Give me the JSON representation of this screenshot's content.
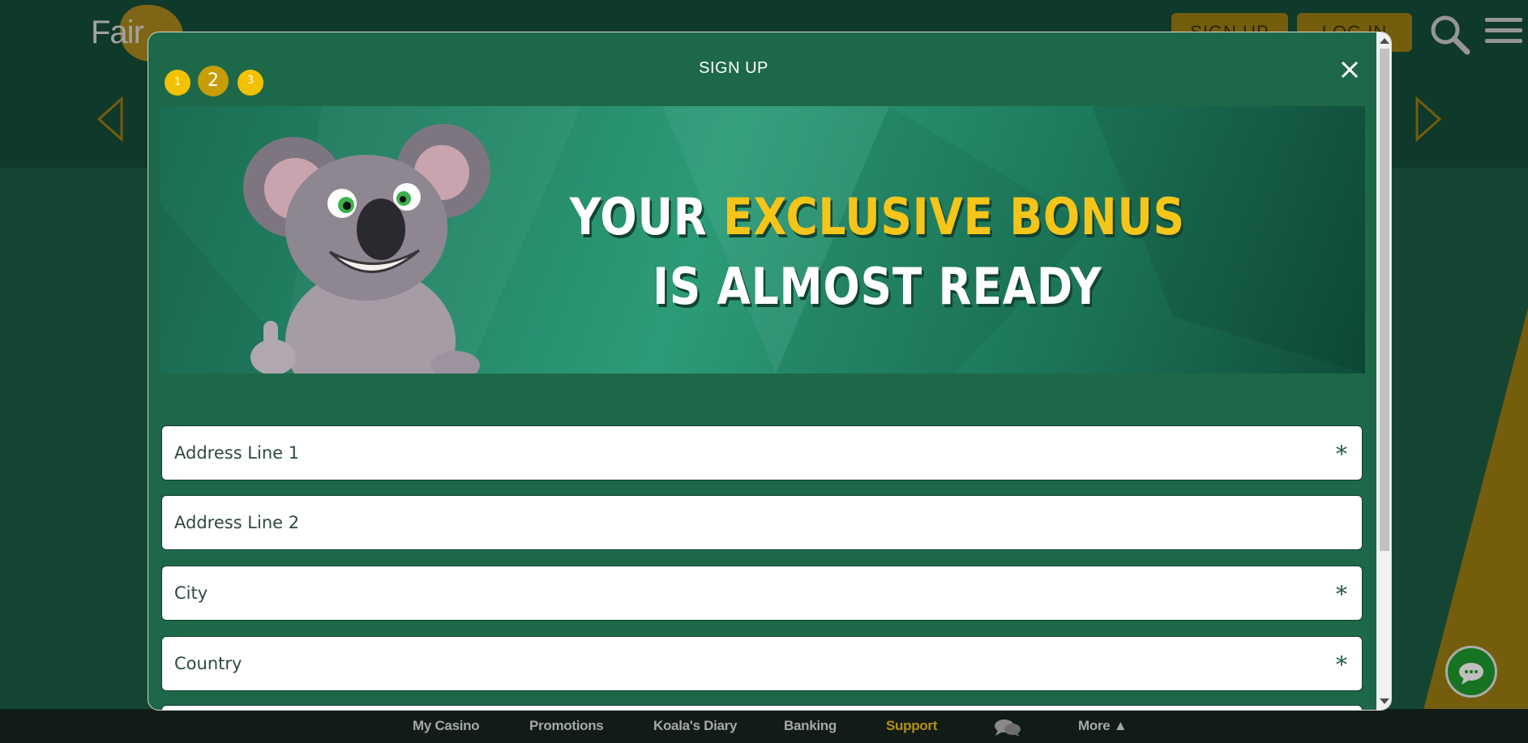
{
  "site": {
    "logo_text": "Fair",
    "header": {
      "signup_label": "SIGN UP",
      "login_label": "LOG IN"
    },
    "bottom_nav": [
      {
        "label": "My Casino"
      },
      {
        "label": "Promotions"
      },
      {
        "label": "Koala's Diary"
      },
      {
        "label": "Banking"
      },
      {
        "label": "Support",
        "active": true
      },
      {
        "label": "",
        "icon": "chat-bubbles-icon"
      },
      {
        "label": "More ▲"
      }
    ]
  },
  "modal": {
    "title": "SIGN UP",
    "steps": [
      "1",
      "2",
      "3"
    ],
    "current_step": 2,
    "banner": {
      "line1_prefix": "YOUR ",
      "line1_highlight": "EXCLUSIVE BONUS",
      "line2": "IS ALMOST READY"
    },
    "fields": [
      {
        "placeholder": "Address Line 1",
        "required": "*"
      },
      {
        "placeholder": "Address Line 2",
        "required": ""
      },
      {
        "placeholder": "City",
        "required": "*"
      },
      {
        "placeholder": "Country",
        "required": "*"
      }
    ]
  },
  "colors": {
    "background": "#1b5c44",
    "modal": "#1e684a",
    "accent_gold": "#f2c200",
    "active_nav": "#b78f12"
  }
}
